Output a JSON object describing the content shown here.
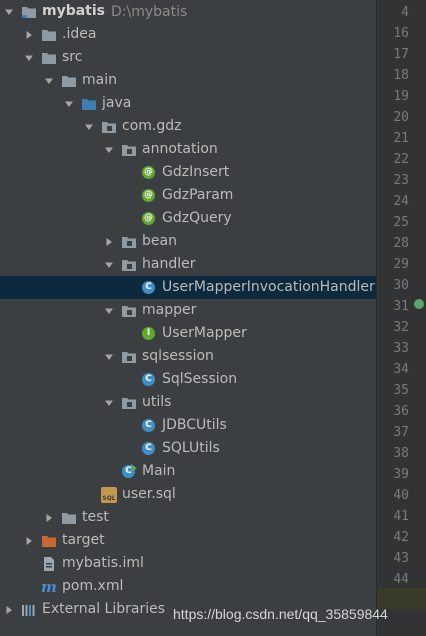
{
  "tree": [
    {
      "label": "mybatis",
      "path": "D:\\mybatis",
      "indent": 0,
      "arrow": "down",
      "icon": "module-folder-icon",
      "strong": true
    },
    {
      "label": ".idea",
      "indent": 1,
      "arrow": "right",
      "icon": "folder-icon"
    },
    {
      "label": "src",
      "indent": 1,
      "arrow": "down",
      "icon": "folder-icon"
    },
    {
      "label": "main",
      "indent": 2,
      "arrow": "down",
      "icon": "folder-icon"
    },
    {
      "label": "java",
      "indent": 3,
      "arrow": "down",
      "icon": "source-folder-icon"
    },
    {
      "label": "com.gdz",
      "indent": 4,
      "arrow": "down",
      "icon": "package-icon"
    },
    {
      "label": "annotation",
      "indent": 5,
      "arrow": "down",
      "icon": "package-icon"
    },
    {
      "label": "GdzInsert",
      "indent": 6,
      "arrow": "none",
      "icon": "annotation-icon"
    },
    {
      "label": "GdzParam",
      "indent": 6,
      "arrow": "none",
      "icon": "annotation-icon"
    },
    {
      "label": "GdzQuery",
      "indent": 6,
      "arrow": "none",
      "icon": "annotation-icon"
    },
    {
      "label": "bean",
      "indent": 5,
      "arrow": "right",
      "icon": "package-icon"
    },
    {
      "label": "handler",
      "indent": 5,
      "arrow": "down",
      "icon": "package-icon"
    },
    {
      "label": "UserMapperInvocationHandler",
      "indent": 6,
      "arrow": "none",
      "icon": "class-icon",
      "selected": true
    },
    {
      "label": "mapper",
      "indent": 5,
      "arrow": "down",
      "icon": "package-icon"
    },
    {
      "label": "UserMapper",
      "indent": 6,
      "arrow": "none",
      "icon": "interface-icon"
    },
    {
      "label": "sqlsession",
      "indent": 5,
      "arrow": "down",
      "icon": "package-icon"
    },
    {
      "label": "SqlSession",
      "indent": 6,
      "arrow": "none",
      "icon": "class-icon"
    },
    {
      "label": "utils",
      "indent": 5,
      "arrow": "down",
      "icon": "package-icon"
    },
    {
      "label": "JDBCUtils",
      "indent": 6,
      "arrow": "none",
      "icon": "class-icon"
    },
    {
      "label": "SQLUtils",
      "indent": 6,
      "arrow": "none",
      "icon": "class-icon"
    },
    {
      "label": "Main",
      "indent": 5,
      "arrow": "none",
      "icon": "main-class-icon"
    },
    {
      "label": "user.sql",
      "indent": 4,
      "arrow": "none",
      "icon": "sql-file-icon"
    },
    {
      "label": "test",
      "indent": 2,
      "arrow": "right",
      "icon": "folder-icon"
    },
    {
      "label": "target",
      "indent": 1,
      "arrow": "right",
      "icon": "excluded-folder-icon"
    },
    {
      "label": "mybatis.iml",
      "indent": 1,
      "arrow": "none",
      "icon": "iml-file-icon"
    },
    {
      "label": "pom.xml",
      "indent": 1,
      "arrow": "none",
      "icon": "maven-icon"
    },
    {
      "label": "External Libraries",
      "indent": 0,
      "arrow": "right",
      "icon": "libraries-icon"
    }
  ],
  "gutter": {
    "lines": [
      "4",
      "16",
      "17",
      "18",
      "19",
      "20",
      "21",
      "22",
      "23",
      "24",
      "25",
      "28",
      "29",
      "30",
      "31",
      "32",
      "33",
      "34",
      "35",
      "36",
      "37",
      "38",
      "39",
      "40",
      "41",
      "42",
      "43",
      "44",
      "45"
    ],
    "current_line": "45"
  },
  "colors": {
    "panel_bg": "#3c3f41",
    "selection_bg": "#0d293e",
    "gutter_bg": "#313335",
    "folder": "#8f9aa2",
    "source_folder": "#3d7fb5",
    "excluded_folder": "#c8692f",
    "class": "#3f8ec7",
    "annotation": "#62a82c"
  },
  "watermark": "https://blog.csdn.net/qq_35859844"
}
